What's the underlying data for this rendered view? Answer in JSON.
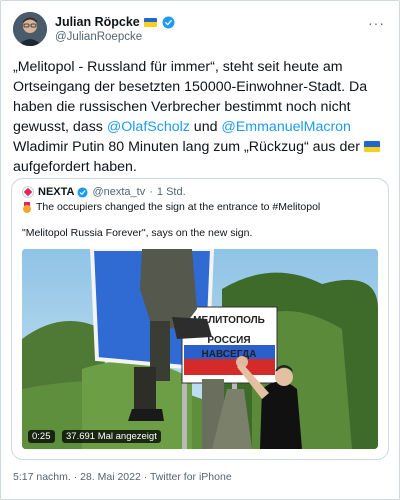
{
  "author": {
    "name": "Julian Röpcke",
    "handle": "@JulianRoepcke",
    "more_icon": "more-dots-icon"
  },
  "tweet": {
    "part1": "„Melitopol - Russland für immer“, steht seit heute am Ortseingang der besetzten 150000-Einwohner-Stadt. Da haben die russischen Verbrecher bestimmt noch nicht gewusst, dass ",
    "mention1": "@OlafScholz",
    "part2": " und ",
    "mention2": "@EmmanuelMacron",
    "part3": " Wladimir Putin 80 Minuten lang zum „Rückzug“ aus der ",
    "part4": " aufgefordert haben."
  },
  "quote": {
    "name": "NEXTA",
    "handle": "@nexta_tv",
    "separator": "·",
    "time": "1 Std.",
    "line1": "The occupiers changed the sign at the entrance to #Melitopol",
    "line2": "\"Melitopol Russia Forever\", says on the new sign.",
    "video_time": "0:25",
    "video_views": "37.691 Mal angezeigt",
    "sign_text_1": "МЕЛИТОПОЛЬ",
    "sign_text_2": "РОССИЯ",
    "sign_text_3": "НАВСЕГДА"
  },
  "footer": {
    "text": "5:17 nachm. · 28. Mai 2022 · Twitter for iPhone"
  },
  "colors": {
    "link": "#1d9bf0",
    "secondary_text": "#536471",
    "border": "#cfd9de",
    "ukraine_blue": "#1f66d1",
    "ukraine_yellow": "#f8cf1c"
  }
}
